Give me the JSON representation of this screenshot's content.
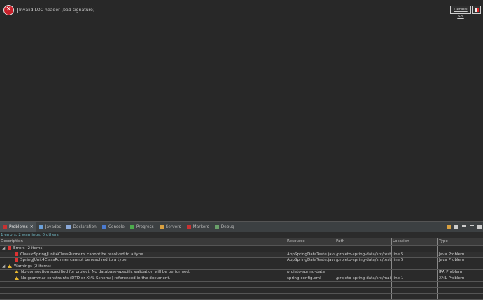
{
  "dialog": {
    "message": "Invalid LOC header (bad signature)",
    "details_label": "Details >>"
  },
  "tabs": [
    {
      "label": "Problems",
      "icon": "problems-icon",
      "active": true,
      "color": "#c83232"
    },
    {
      "label": "Javadoc",
      "icon": "javadoc-icon",
      "color": "#6a9fd8"
    },
    {
      "label": "Declaration",
      "icon": "declaration-icon",
      "color": "#8aa8d8"
    },
    {
      "label": "Console",
      "icon": "console-icon",
      "color": "#4a7ad0"
    },
    {
      "label": "Progress",
      "icon": "progress-icon",
      "color": "#4caa4c"
    },
    {
      "label": "Servers",
      "icon": "servers-icon",
      "color": "#d8a040"
    },
    {
      "label": "Markers",
      "icon": "markers-icon",
      "color": "#c83232"
    },
    {
      "label": "Debug",
      "icon": "debug-icon",
      "color": "#6aa06a"
    }
  ],
  "summary": "1 errors, 2 warnings, 0 others",
  "columns": [
    "Description",
    "Resource",
    "Path",
    "Location",
    "Type"
  ],
  "rows": [
    {
      "kind": "group",
      "icon": "error",
      "desc": "Errors (2 items)",
      "res": "",
      "path": "",
      "loc": "",
      "type": ""
    },
    {
      "kind": "error",
      "desc": "Class<SpringJUnit4ClassRunner> cannot be resolved to a type",
      "res": "AppSpringDataTeste.java",
      "path": "/projeto-spring-data/src/test...",
      "loc": "line 5",
      "type": "Java Problem"
    },
    {
      "kind": "error",
      "desc": "SpringJUnit4ClassRunner cannot be resolved to a type",
      "res": "AppSpringDataTeste.java",
      "path": "/projeto-spring-data/src/test...",
      "loc": "line 5",
      "type": "Java Problem"
    },
    {
      "kind": "group",
      "icon": "warning",
      "desc": "Warnings (2 items)",
      "res": "",
      "path": "",
      "loc": "",
      "type": ""
    },
    {
      "kind": "warning",
      "desc": "No connection specified for project. No database-specific validation will be performed.",
      "res": "projeto-spring-data",
      "path": "",
      "loc": "",
      "type": "JPA Problem"
    },
    {
      "kind": "warning",
      "desc": "No grammar constraints (DTD or XML Schema) referenced in the document.",
      "res": "spring-config.xml",
      "path": "/projeto-spring-data/src/mai...",
      "loc": "line 1",
      "type": "XML Problem"
    }
  ]
}
